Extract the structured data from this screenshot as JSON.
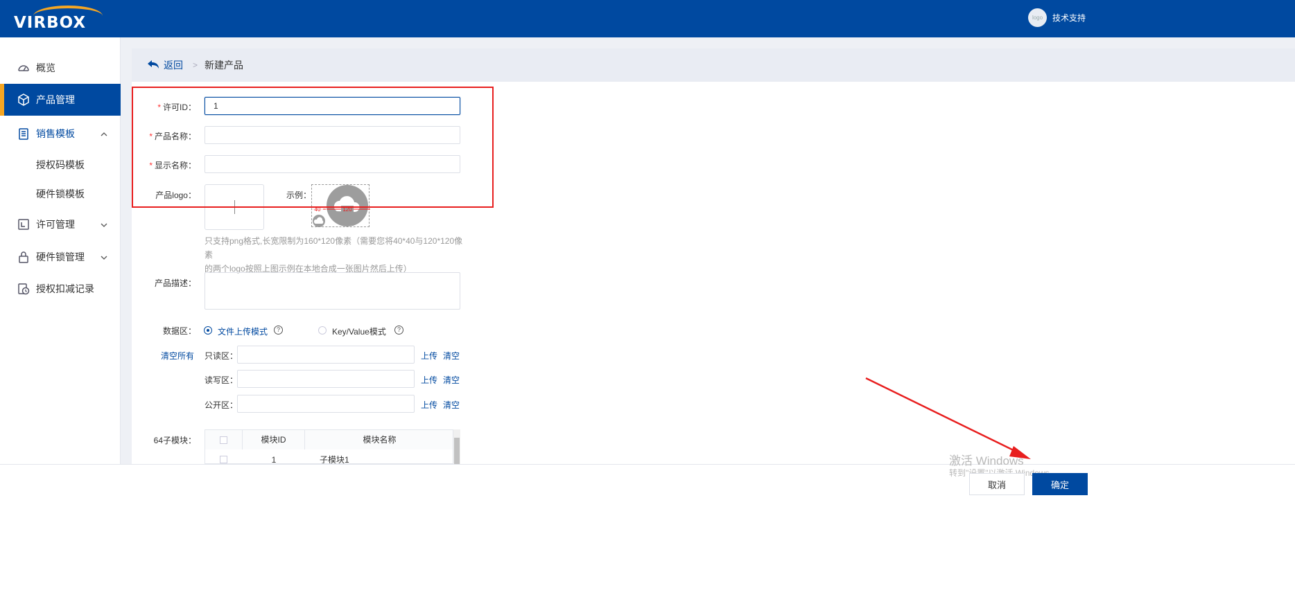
{
  "header": {
    "logo_text": "VIRBOX",
    "avatar_text": "logo",
    "user_name": "技术支持"
  },
  "sidebar": {
    "items": [
      {
        "label": "概览",
        "icon": "dashboard-icon"
      },
      {
        "label": "产品管理",
        "icon": "box-icon"
      },
      {
        "label": "销售模板",
        "icon": "template-icon"
      },
      {
        "label": "授权码模板"
      },
      {
        "label": "硬件锁模板"
      },
      {
        "label": "许可管理",
        "icon": "license-icon"
      },
      {
        "label": "硬件锁管理",
        "icon": "lock-icon"
      },
      {
        "label": "授权扣减记录",
        "icon": "history-icon"
      }
    ]
  },
  "breadcrumb": {
    "back": "返回",
    "current": "新建产品"
  },
  "form": {
    "license_id_label": "许可ID：",
    "license_id_value": "1",
    "product_name_label": "产品名称：",
    "display_name_label": "显示名称：",
    "logo_label": "产品logo：",
    "example_label": "示例：",
    "example_small": "40",
    "example_large": "120",
    "hint_line1": "只支持png格式,长宽限制为160*120像素（需要您将40*40与120*120像素",
    "hint_line2": "的两个logo按照上图示例在本地合成一张图片然后上传）",
    "desc_label": "产品描述：",
    "data_area_label": "数据区：",
    "mode_file": "文件上传模式",
    "mode_kv": "Key/Value模式",
    "clear_all": "清空所有",
    "readonly_label": "只读区：",
    "readwrite_label": "读写区：",
    "public_label": "公开区：",
    "upload": "上传",
    "clear": "清空",
    "modules_label": "64子模块：",
    "table_headers": [
      "模块ID",
      "模块名称"
    ],
    "table_rows": [
      {
        "id": "1",
        "name": "子模块1"
      }
    ]
  },
  "footer": {
    "cancel": "取消",
    "ok": "确定"
  },
  "watermark": {
    "line1": "激活 Windows",
    "line2": "转到\"设置\"以激活 Windows。"
  },
  "colors": {
    "brand": "#0049a0",
    "accent": "#f5a623",
    "annotation": "#e81e1e"
  }
}
